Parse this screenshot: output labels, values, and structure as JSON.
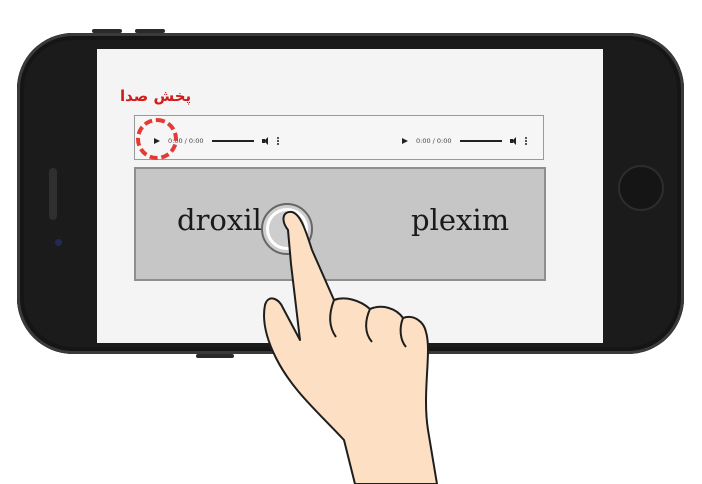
{
  "section_title": "پخش صدا",
  "audio_players": [
    {
      "time": "0:00 / 0:00"
    },
    {
      "time": "0:00 / 0:00"
    }
  ],
  "word_choices": [
    {
      "text": "droxil"
    },
    {
      "text": "plexim"
    }
  ],
  "colors": {
    "title": "#d21b1b",
    "highlight_circle": "#e53935",
    "choice_bg": "#c6c6c6"
  },
  "icons": [
    "play-icon",
    "volume-icon",
    "more-options-icon",
    "tap-hand-icon"
  ]
}
